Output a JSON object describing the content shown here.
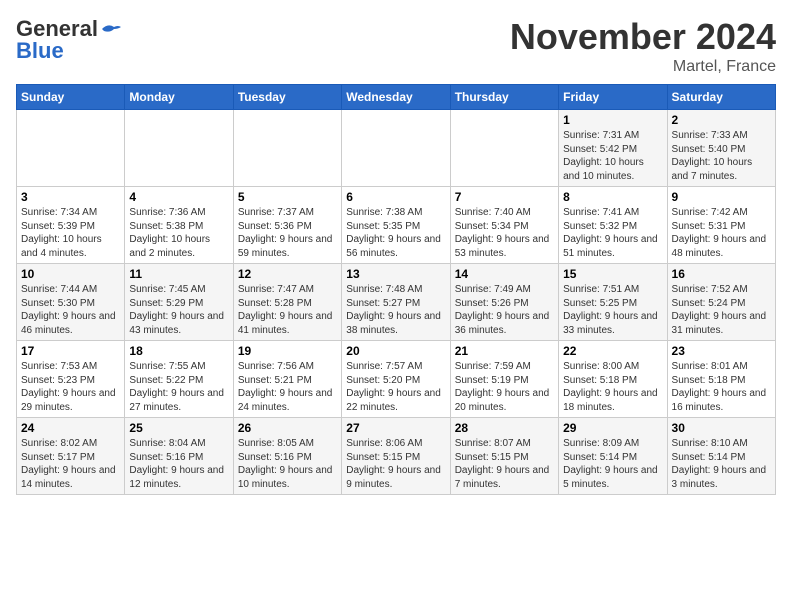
{
  "logo": {
    "text_general": "General",
    "text_blue": "Blue"
  },
  "title": "November 2024",
  "subtitle": "Martel, France",
  "days_header": [
    "Sunday",
    "Monday",
    "Tuesday",
    "Wednesday",
    "Thursday",
    "Friday",
    "Saturday"
  ],
  "weeks": [
    [
      {
        "num": "",
        "info": ""
      },
      {
        "num": "",
        "info": ""
      },
      {
        "num": "",
        "info": ""
      },
      {
        "num": "",
        "info": ""
      },
      {
        "num": "",
        "info": ""
      },
      {
        "num": "1",
        "info": "Sunrise: 7:31 AM\nSunset: 5:42 PM\nDaylight: 10 hours and 10 minutes."
      },
      {
        "num": "2",
        "info": "Sunrise: 7:33 AM\nSunset: 5:40 PM\nDaylight: 10 hours and 7 minutes."
      }
    ],
    [
      {
        "num": "3",
        "info": "Sunrise: 7:34 AM\nSunset: 5:39 PM\nDaylight: 10 hours and 4 minutes."
      },
      {
        "num": "4",
        "info": "Sunrise: 7:36 AM\nSunset: 5:38 PM\nDaylight: 10 hours and 2 minutes."
      },
      {
        "num": "5",
        "info": "Sunrise: 7:37 AM\nSunset: 5:36 PM\nDaylight: 9 hours and 59 minutes."
      },
      {
        "num": "6",
        "info": "Sunrise: 7:38 AM\nSunset: 5:35 PM\nDaylight: 9 hours and 56 minutes."
      },
      {
        "num": "7",
        "info": "Sunrise: 7:40 AM\nSunset: 5:34 PM\nDaylight: 9 hours and 53 minutes."
      },
      {
        "num": "8",
        "info": "Sunrise: 7:41 AM\nSunset: 5:32 PM\nDaylight: 9 hours and 51 minutes."
      },
      {
        "num": "9",
        "info": "Sunrise: 7:42 AM\nSunset: 5:31 PM\nDaylight: 9 hours and 48 minutes."
      }
    ],
    [
      {
        "num": "10",
        "info": "Sunrise: 7:44 AM\nSunset: 5:30 PM\nDaylight: 9 hours and 46 minutes."
      },
      {
        "num": "11",
        "info": "Sunrise: 7:45 AM\nSunset: 5:29 PM\nDaylight: 9 hours and 43 minutes."
      },
      {
        "num": "12",
        "info": "Sunrise: 7:47 AM\nSunset: 5:28 PM\nDaylight: 9 hours and 41 minutes."
      },
      {
        "num": "13",
        "info": "Sunrise: 7:48 AM\nSunset: 5:27 PM\nDaylight: 9 hours and 38 minutes."
      },
      {
        "num": "14",
        "info": "Sunrise: 7:49 AM\nSunset: 5:26 PM\nDaylight: 9 hours and 36 minutes."
      },
      {
        "num": "15",
        "info": "Sunrise: 7:51 AM\nSunset: 5:25 PM\nDaylight: 9 hours and 33 minutes."
      },
      {
        "num": "16",
        "info": "Sunrise: 7:52 AM\nSunset: 5:24 PM\nDaylight: 9 hours and 31 minutes."
      }
    ],
    [
      {
        "num": "17",
        "info": "Sunrise: 7:53 AM\nSunset: 5:23 PM\nDaylight: 9 hours and 29 minutes."
      },
      {
        "num": "18",
        "info": "Sunrise: 7:55 AM\nSunset: 5:22 PM\nDaylight: 9 hours and 27 minutes."
      },
      {
        "num": "19",
        "info": "Sunrise: 7:56 AM\nSunset: 5:21 PM\nDaylight: 9 hours and 24 minutes."
      },
      {
        "num": "20",
        "info": "Sunrise: 7:57 AM\nSunset: 5:20 PM\nDaylight: 9 hours and 22 minutes."
      },
      {
        "num": "21",
        "info": "Sunrise: 7:59 AM\nSunset: 5:19 PM\nDaylight: 9 hours and 20 minutes."
      },
      {
        "num": "22",
        "info": "Sunrise: 8:00 AM\nSunset: 5:18 PM\nDaylight: 9 hours and 18 minutes."
      },
      {
        "num": "23",
        "info": "Sunrise: 8:01 AM\nSunset: 5:18 PM\nDaylight: 9 hours and 16 minutes."
      }
    ],
    [
      {
        "num": "24",
        "info": "Sunrise: 8:02 AM\nSunset: 5:17 PM\nDaylight: 9 hours and 14 minutes."
      },
      {
        "num": "25",
        "info": "Sunrise: 8:04 AM\nSunset: 5:16 PM\nDaylight: 9 hours and 12 minutes."
      },
      {
        "num": "26",
        "info": "Sunrise: 8:05 AM\nSunset: 5:16 PM\nDaylight: 9 hours and 10 minutes."
      },
      {
        "num": "27",
        "info": "Sunrise: 8:06 AM\nSunset: 5:15 PM\nDaylight: 9 hours and 9 minutes."
      },
      {
        "num": "28",
        "info": "Sunrise: 8:07 AM\nSunset: 5:15 PM\nDaylight: 9 hours and 7 minutes."
      },
      {
        "num": "29",
        "info": "Sunrise: 8:09 AM\nSunset: 5:14 PM\nDaylight: 9 hours and 5 minutes."
      },
      {
        "num": "30",
        "info": "Sunrise: 8:10 AM\nSunset: 5:14 PM\nDaylight: 9 hours and 3 minutes."
      }
    ]
  ]
}
